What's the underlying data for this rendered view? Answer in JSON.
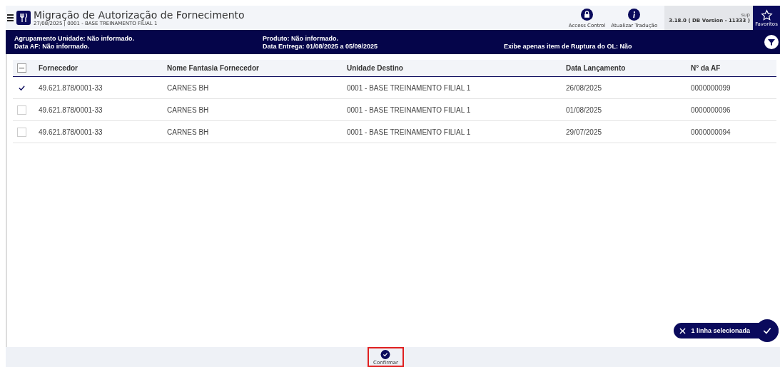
{
  "header": {
    "title": "Migração de Autorização de Fornecimento",
    "subtitle": "27/08/2025 | 0001 - BASE TREINAMENTO FILIAL 1",
    "actions": [
      {
        "label": "Access Control",
        "kind": "lock"
      },
      {
        "label": "Atualizar Tradução",
        "kind": "info"
      }
    ],
    "user": "sup",
    "version": "3.18.0 ( DB Version - 11333 )",
    "favorites": "Favoritos"
  },
  "filter_rows": [
    [
      "Agrupamento Unidade: Não informado.",
      "Produto: Não informado."
    ],
    [
      "Data AF: Não informado.",
      "Data Entrega: 01/08/2025 a 05/09/2025",
      "Exibe apenas item de Ruptura do OL: Não"
    ]
  ],
  "table": {
    "select_all_indeterminate": true,
    "columns": [
      "Fornecedor",
      "Nome Fantasia Fornecedor",
      "Unidade Destino",
      "Data Lançamento",
      "N° da AF"
    ],
    "rows": [
      {
        "selected": true,
        "cells": [
          "49.621.878/0001-33",
          "CARNES BH",
          "0001 - BASE TREINAMENTO FILIAL 1",
          "26/08/2025",
          "0000000099"
        ]
      },
      {
        "selected": false,
        "cells": [
          "49.621.878/0001-33",
          "CARNES BH",
          "0001 - BASE TREINAMENTO FILIAL 1",
          "01/08/2025",
          "0000000096"
        ]
      },
      {
        "selected": false,
        "cells": [
          "49.621.878/0001-33",
          "CARNES BH",
          "0001 - BASE TREINAMENTO FILIAL 1",
          "29/07/2025",
          "0000000094"
        ]
      }
    ]
  },
  "selection_pill": "1 linha selecionada",
  "footer": {
    "button": "Confirmar"
  }
}
